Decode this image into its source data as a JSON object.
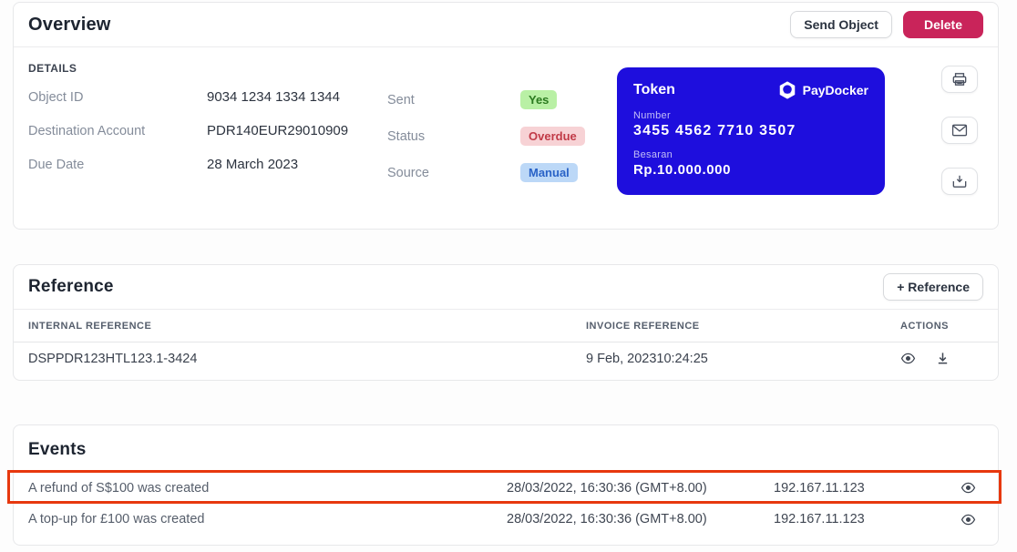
{
  "overview": {
    "title": "Overview",
    "send_button_label": "Send Object",
    "delete_button_label": "Delete",
    "details_heading": "DETAILS",
    "fields": [
      {
        "label": "Object ID",
        "value": "9034 1234 1334 1344"
      },
      {
        "label": "Destination Account",
        "value": "PDR140EUR29010909"
      },
      {
        "label": "Due Date",
        "value": "28 March 2023"
      }
    ],
    "statuses": [
      {
        "label": "Sent",
        "value": "Yes",
        "style": "background:#b9f0a5;color:#2b7a1f;"
      },
      {
        "label": "Status",
        "value": "Overdue",
        "style": "background:#f7d2d5;color:#c13a47;"
      },
      {
        "label": "Source",
        "value": "Manual",
        "style": "background:#bcd8f7;color:#2a63c7;"
      }
    ],
    "token_card": {
      "title": "Token",
      "brand": "PayDocker",
      "number_label": "Number",
      "number": "3455 4562 7710 3507",
      "amount_label": "Besaran",
      "amount": "Rp.10.000.000"
    },
    "side_icons": [
      "printer-icon",
      "mail-icon",
      "download-icon"
    ]
  },
  "reference": {
    "title": "Reference",
    "add_button_plus": "+",
    "add_button_label": "Reference",
    "columns": [
      "INTERNAL REFERENCE",
      "INVOICE REFERENCE",
      "ACTIONS"
    ],
    "rows": [
      {
        "internal": "DSPPDR123HTL123.1-3424",
        "invoice": "9 Feb, 202310:24:25"
      }
    ]
  },
  "events": {
    "title": "Events",
    "rows": [
      {
        "description": "A refund of S$100 was created",
        "timestamp": "28/03/2022, 16:30:36 (GMT+8.00)",
        "ip": "192.167.11.123",
        "highlighted": true
      },
      {
        "description": "A top-up for £100 was created",
        "timestamp": "28/03/2022, 16:30:36 (GMT+8.00)",
        "ip": "192.167.11.123",
        "highlighted": false
      }
    ]
  },
  "colors": {
    "accent_blue_card": "#1e0edd",
    "delete_button": "#c9245a",
    "highlight_border": "#e7380e",
    "badge_yes_bg": "#b9f0a5",
    "badge_overdue_bg": "#f7d2d5",
    "badge_manual_bg": "#bcd8f7"
  }
}
